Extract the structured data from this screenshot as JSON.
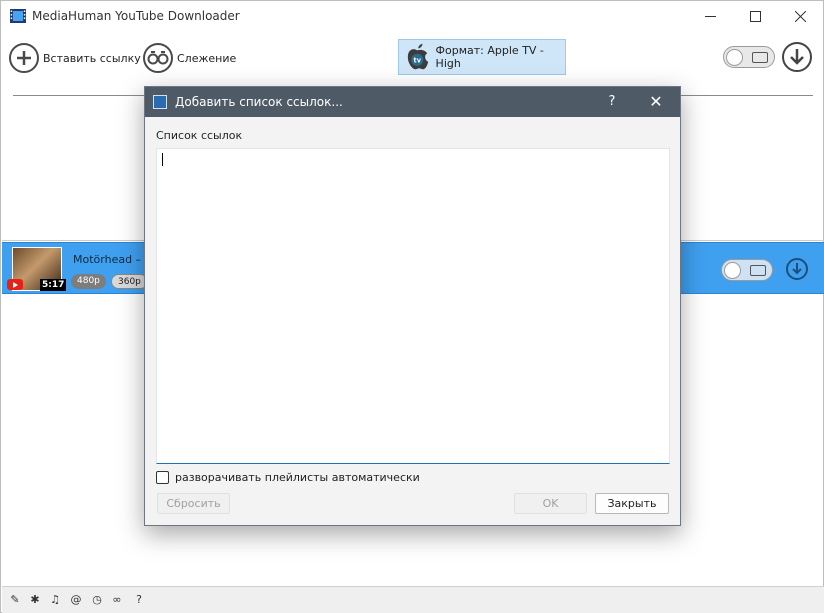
{
  "window": {
    "title": "MediaHuman YouTube Downloader",
    "icon": "film-strip-icon"
  },
  "toolbar": {
    "paste_label": "Вставить ссылку",
    "tracking_label": "Слежение",
    "format_label": "Формат: Apple TV - High"
  },
  "video": {
    "title": "Motörhead – O",
    "duration": "5:17",
    "resolutions": [
      "480p",
      "360p"
    ]
  },
  "dialog": {
    "title": "Добавить список ссылок...",
    "help": "?",
    "list_label": "Список ссылок",
    "textarea_value": "",
    "checkbox_label": "разворачивать плейлисты автоматически",
    "checkbox_checked": false,
    "reset_label": "Сбросить",
    "ok_label": "OK",
    "close_label": "Закрыть"
  },
  "statusbar": {
    "help": "?"
  },
  "colors": {
    "dialog_titlebar": "#4e5a66",
    "selected_row": "#3fa0f0",
    "format_button": "#cfe6f8"
  }
}
